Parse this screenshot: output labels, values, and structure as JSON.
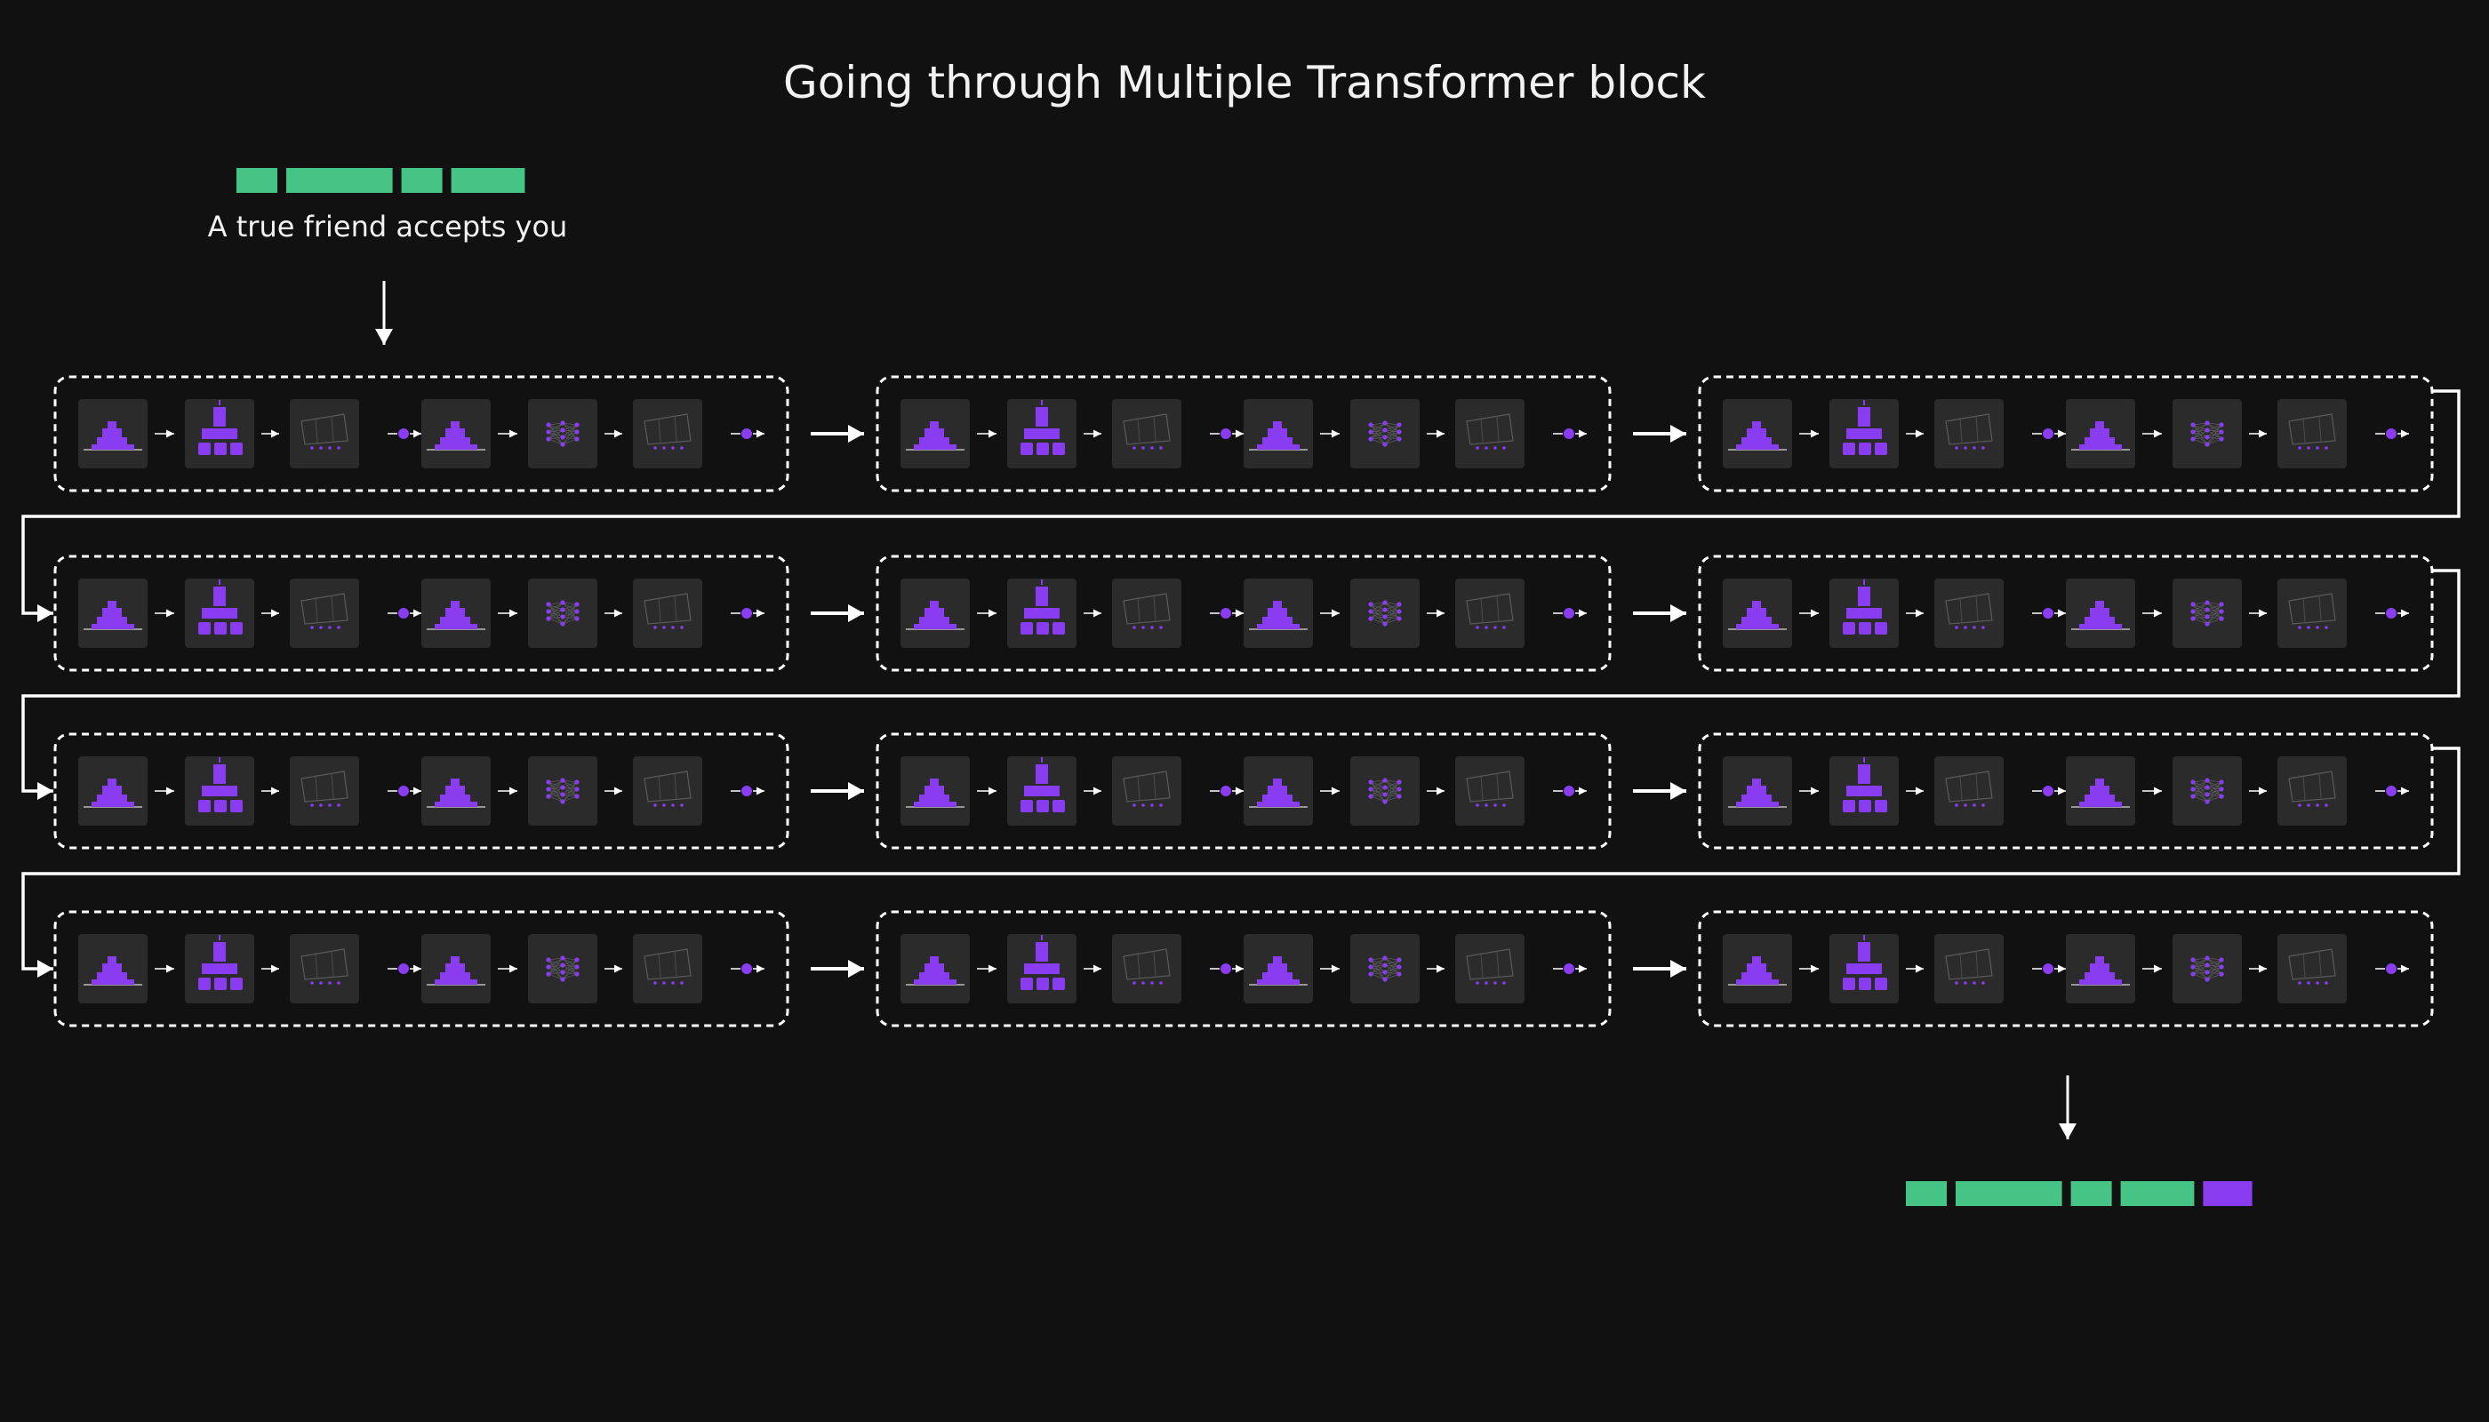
{
  "title": "Going through Multiple Transformer block",
  "input": {
    "text": "A true friend accepts you",
    "tokens": [
      {
        "color": "#45c486",
        "w": 1
      },
      {
        "color": "#45c486",
        "w": 2.6
      },
      {
        "color": "#45c486",
        "w": 1
      },
      {
        "color": "#45c486",
        "w": 1.8
      }
    ]
  },
  "output": {
    "tokens": [
      {
        "color": "#45c486",
        "w": 1
      },
      {
        "color": "#45c486",
        "w": 2.6
      },
      {
        "color": "#45c486",
        "w": 1
      },
      {
        "color": "#45c486",
        "w": 1.8
      },
      {
        "color": "#8a3cf0",
        "w": 1.2
      }
    ]
  },
  "grid": {
    "rows": 4,
    "cols": 3
  },
  "block_steps": [
    "layer-norm",
    "attention",
    "projection",
    "residual-add",
    "layer-norm",
    "feed-forward",
    "projection",
    "residual-add"
  ],
  "colors": {
    "background": "#111111",
    "accent": "#8a3cf0",
    "token": "#45c486",
    "tile": "#2b2b2b",
    "stroke": "#ffffff"
  }
}
